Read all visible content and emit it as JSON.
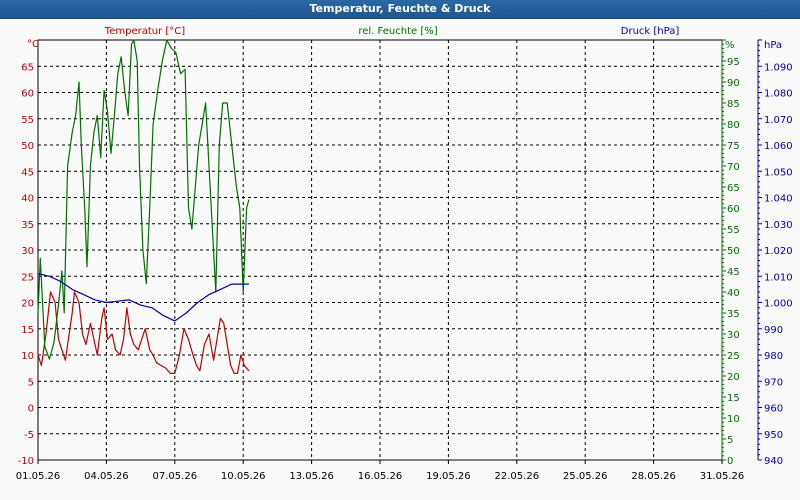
{
  "window": {
    "title": "Temperatur, Feuchte & Druck"
  },
  "colors": {
    "temperature": "#c00000",
    "humidity": "#007000",
    "pressure": "#0000b0",
    "grid": "#000000"
  },
  "chart_data": {
    "type": "line",
    "title": "Temperatur, Feuchte & Druck",
    "x_ticks": [
      "01.05.26",
      "04.05.26",
      "07.05.26",
      "10.05.26",
      "13.05.26",
      "16.05.26",
      "19.05.26",
      "22.05.26",
      "25.05.26",
      "28.05.26",
      "31.05.26"
    ],
    "xlim": [
      0,
      30
    ],
    "x_unit_note": "days after 01.05.26",
    "axes": {
      "temperature": {
        "label": "Temperatur [°C]",
        "unit": "°C",
        "ylim": [
          -10,
          70
        ],
        "ticks": [
          65,
          60,
          55,
          50,
          45,
          40,
          35,
          30,
          25,
          20,
          15,
          10,
          5,
          0,
          -5,
          -10
        ]
      },
      "humidity": {
        "label": "rel. Feuchte [%]",
        "unit": "%",
        "ylim": [
          0,
          100
        ],
        "ticks": [
          95,
          90,
          85,
          80,
          75,
          70,
          65,
          60,
          55,
          50,
          45,
          40,
          35,
          30,
          25,
          20,
          15,
          10,
          5,
          0
        ]
      },
      "pressure": {
        "label": "Druck [hPa]",
        "unit": "hPa",
        "ylim": [
          940,
          1100
        ],
        "ticks": [
          "1.090",
          "1.080",
          "1.070",
          "1.060",
          "1.050",
          "1.040",
          "1.030",
          "1.020",
          "1.010",
          "1.000",
          "990",
          "980",
          "970",
          "960",
          "950",
          "940"
        ]
      }
    },
    "series": [
      {
        "name": "Temperatur [°C]",
        "axis": "temperature",
        "x": [
          0,
          0.15,
          0.35,
          0.55,
          0.75,
          0.9,
          1.05,
          1.2,
          1.4,
          1.5,
          1.6,
          1.8,
          1.95,
          2.1,
          2.3,
          2.45,
          2.6,
          2.8,
          2.9,
          3.05,
          3.25,
          3.4,
          3.6,
          3.75,
          3.9,
          4.05,
          4.2,
          4.4,
          4.55,
          4.7,
          4.9,
          5.05,
          5.2,
          5.4,
          5.6,
          5.8,
          6.0,
          6.2,
          6.4,
          6.6,
          6.8,
          6.95,
          7.1,
          7.3,
          7.5,
          7.7,
          7.85,
          8.0,
          8.15,
          8.3,
          8.45,
          8.6,
          8.75,
          8.9,
          9.05,
          9.25
        ],
        "y": [
          10,
          8,
          14,
          22,
          20,
          13,
          11,
          9,
          15,
          18,
          22,
          20,
          14,
          12,
          16,
          13,
          10,
          17,
          19,
          13,
          14,
          11,
          10,
          13,
          19,
          14,
          12,
          11,
          13,
          15,
          11,
          10,
          8.5,
          8,
          7.5,
          6.5,
          6.5,
          10,
          15,
          13,
          10,
          8,
          7,
          12,
          14,
          9,
          13,
          17,
          16,
          12,
          8,
          6.5,
          6.5,
          10,
          8,
          7
        ]
      },
      {
        "name": "rel. Feuchte [%]",
        "axis": "humidity",
        "x": [
          0,
          0.1,
          0.3,
          0.5,
          0.7,
          0.9,
          1.05,
          1.15,
          1.3,
          1.5,
          1.65,
          1.8,
          1.9,
          2.05,
          2.15,
          2.3,
          2.45,
          2.6,
          2.75,
          2.9,
          3.05,
          3.2,
          3.35,
          3.5,
          3.65,
          3.8,
          3.95,
          4.1,
          4.2,
          4.35,
          4.45,
          4.6,
          4.75,
          4.9,
          5.05,
          5.25,
          5.45,
          5.65,
          5.85,
          6.05,
          6.25,
          6.45,
          6.6,
          6.75,
          6.9,
          7.05,
          7.2,
          7.35,
          7.5,
          7.65,
          7.8,
          7.95,
          8.1,
          8.3,
          8.5,
          8.7,
          8.85,
          9.0,
          9.15,
          9.25
        ],
        "y": [
          35,
          48,
          27,
          24,
          28,
          37,
          45,
          35,
          70,
          78,
          82,
          90,
          75,
          60,
          46,
          70,
          78,
          82,
          72,
          88,
          83,
          73,
          82,
          92,
          96,
          88,
          82,
          99,
          100,
          95,
          70,
          50,
          42,
          60,
          80,
          88,
          95,
          100,
          98,
          97,
          92,
          93,
          60,
          55,
          65,
          75,
          80,
          85,
          70,
          55,
          40,
          75,
          85,
          85,
          75,
          65,
          60,
          40,
          60,
          62
        ]
      },
      {
        "name": "Druck [hPa]",
        "axis": "pressure",
        "x": [
          0,
          0.5,
          1.0,
          1.5,
          2.0,
          2.5,
          3.0,
          3.5,
          4.0,
          4.5,
          5.0,
          5.5,
          6.0,
          6.5,
          7.0,
          7.5,
          8.0,
          8.5,
          9.0,
          9.25
        ],
        "y": [
          1011,
          1010,
          1008,
          1005,
          1003,
          1001,
          1000,
          1000.5,
          1001,
          999,
          998,
          995,
          993,
          996,
          1000,
          1003,
          1005,
          1007,
          1007,
          1007
        ]
      }
    ],
    "grid": true
  }
}
